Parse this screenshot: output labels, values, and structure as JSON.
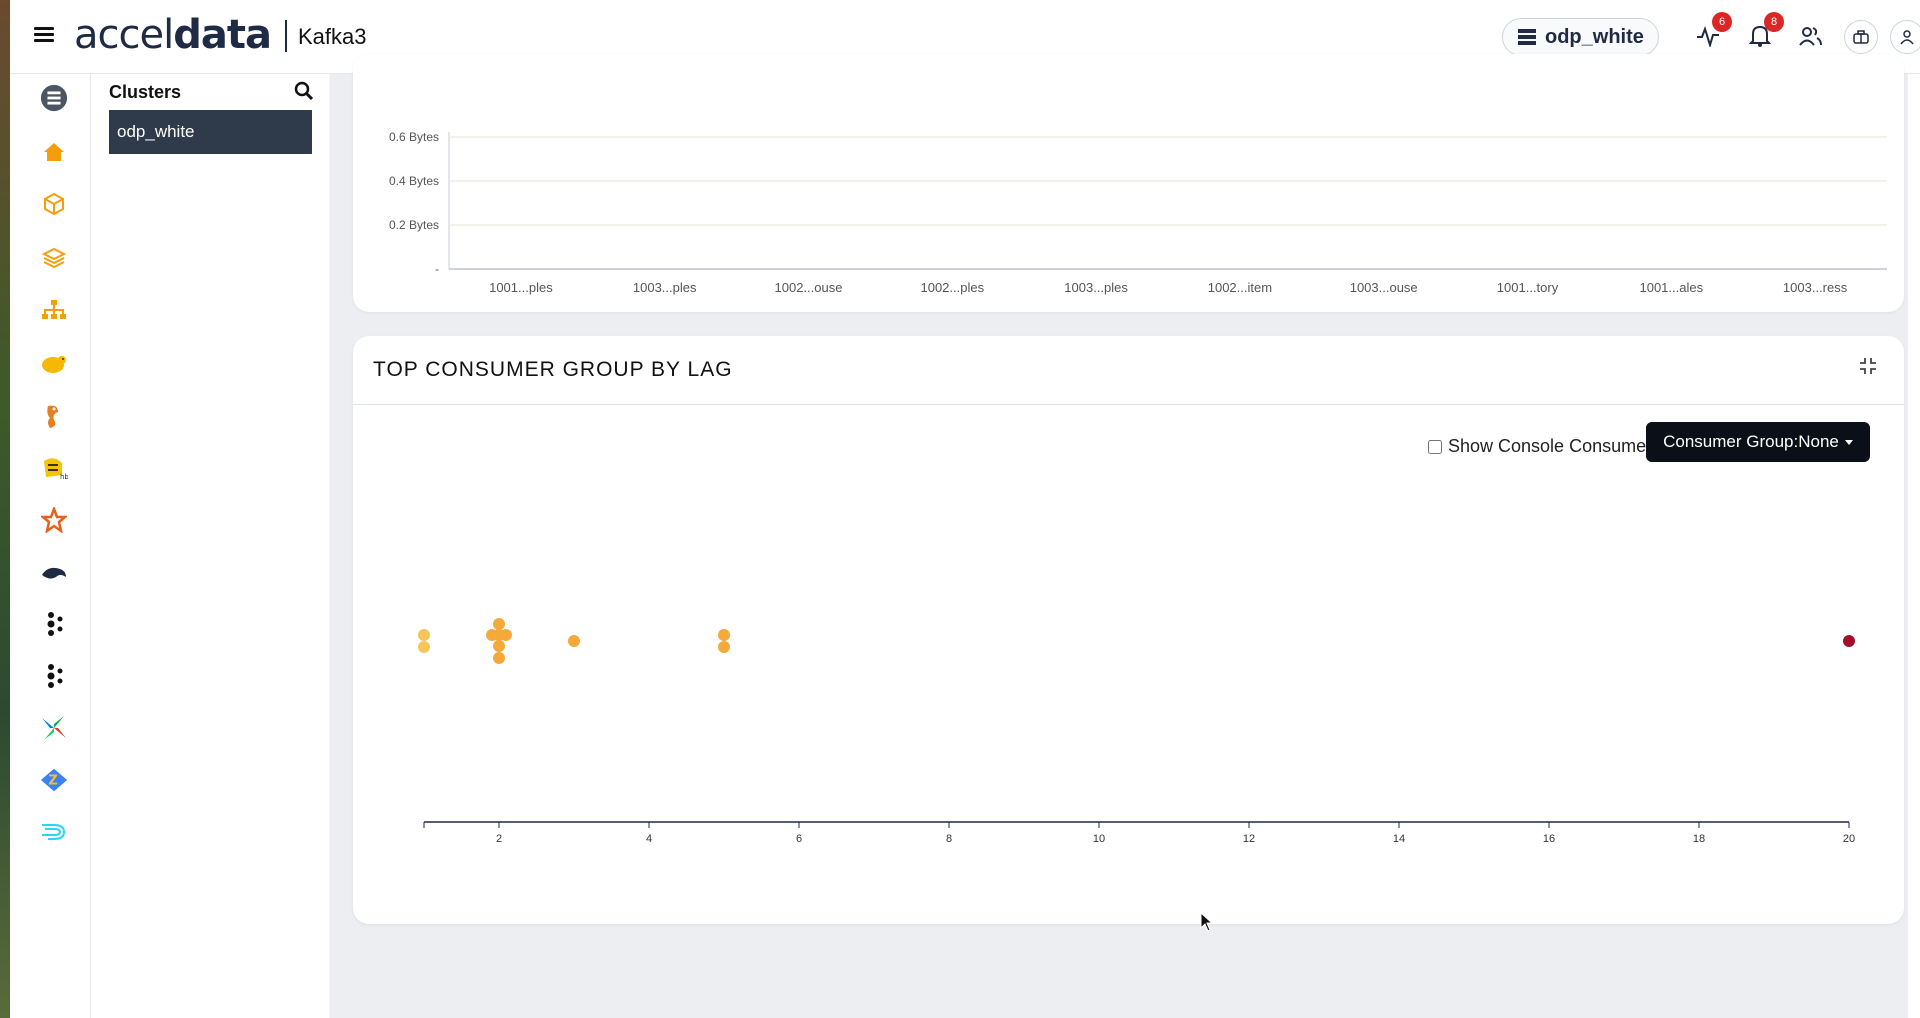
{
  "header": {
    "logo_light": "accel",
    "logo_bold": "data",
    "logo_light2": "",
    "service": "Kafka3",
    "cluster_pill": "odp_white",
    "activity_badge": "6",
    "alerts_badge": "8"
  },
  "clusters": {
    "title": "Clusters",
    "items": [
      "odp_white"
    ]
  },
  "bytes_chart": {
    "chart_data": {
      "type": "bar",
      "categories": [
        "1001...ples",
        "1003...ples",
        "1002...ouse",
        "1002...ples",
        "1003...ples",
        "1002...item",
        "1003...ouse",
        "1001...tory",
        "1001...ales",
        "1003...ress"
      ],
      "values": [
        0,
        0,
        0,
        0,
        0,
        0,
        0,
        0,
        0,
        0
      ],
      "yticks": [
        "-",
        "0.2 Bytes",
        "0.4 Bytes",
        "0.6 Bytes"
      ]
    }
  },
  "consumer_lag": {
    "title": "TOP CONSUMER GROUP BY LAG",
    "show_console_label": "Show Console Consumer",
    "consumer_group_button": "Consumer Group:None",
    "chart_data": {
      "type": "scatter",
      "xlim": [
        1,
        20
      ],
      "xticks": [
        2,
        4,
        6,
        8,
        10,
        12,
        14,
        16,
        18,
        20
      ],
      "points": [
        {
          "x": 1,
          "color": "#f5c55a"
        },
        {
          "x": 1,
          "color": "#f5c55a"
        },
        {
          "x": 2,
          "color": "#f4a93a"
        },
        {
          "x": 2,
          "color": "#f4a93a"
        },
        {
          "x": 2,
          "color": "#f4a93a"
        },
        {
          "x": 2,
          "color": "#f4a93a"
        },
        {
          "x": 2,
          "color": "#f4a93a"
        },
        {
          "x": 2,
          "color": "#f4a93a"
        },
        {
          "x": 3,
          "color": "#f4a93a"
        },
        {
          "x": 5,
          "color": "#f4a93a"
        },
        {
          "x": 5,
          "color": "#f4a93a"
        },
        {
          "x": 20,
          "color": "#a0102a"
        }
      ]
    }
  },
  "sidebar_icons": [
    "server-icon",
    "home-icon",
    "cube-icon",
    "layers-icon",
    "hierarchy-icon",
    "hadoop-icon",
    "hive-icon",
    "hbase-icon",
    "spark-icon",
    "mysql-icon",
    "kafka-icon",
    "kafka-icon-2",
    "airflow-icon",
    "zeppelin-icon",
    "druid-icon"
  ]
}
